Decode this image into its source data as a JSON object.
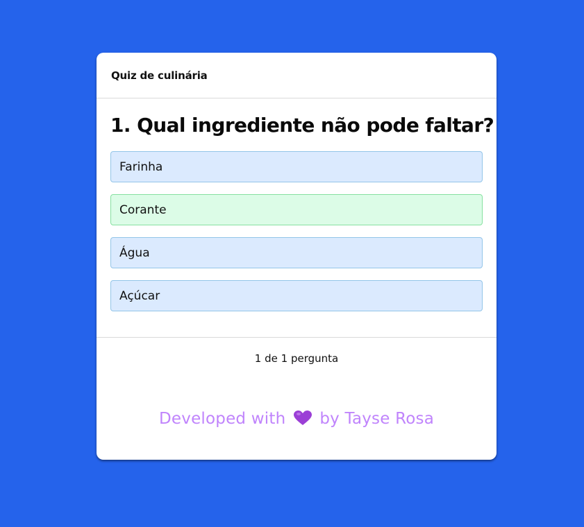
{
  "quiz": {
    "title": "Quiz de culinária",
    "question": "1. Qual ingrediente não pode faltar?",
    "options": [
      {
        "label": "Farinha",
        "state": "default"
      },
      {
        "label": "Corante",
        "state": "correct"
      },
      {
        "label": "Água",
        "state": "default"
      },
      {
        "label": "Açúcar",
        "state": "default"
      }
    ],
    "progress": "1 de 1 pergunta"
  },
  "credit": {
    "prefix": "Developed with",
    "icon": "purple-heart-icon",
    "suffix": "by Tayse Rosa"
  },
  "colors": {
    "background": "#2563eb",
    "option_bg": "#dbeafe",
    "option_correct_bg": "#dcfce7",
    "credit_text": "#c084fc",
    "heart": "#9b3fd6"
  }
}
